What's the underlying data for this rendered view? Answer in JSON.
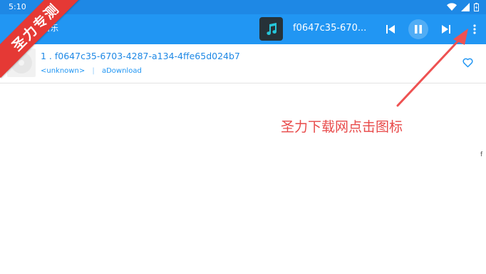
{
  "status_bar": {
    "time": "5:10"
  },
  "app_bar": {
    "title_fragment": "音乐",
    "now_playing_title": "f0647c35-670..."
  },
  "track_list": [
    {
      "title": "1 . f0647c35-6703-4287-a134-4ffe65d024b7",
      "artist": "<unknown>",
      "separator": "|",
      "album": "aDownload"
    }
  ],
  "overlay": {
    "watermark": "圣力专测",
    "annotation": "圣力下载网点击图标",
    "edge_glyph": "f"
  },
  "colors": {
    "status_bar": "#1e88e5",
    "app_bar": "#2196f3",
    "accent_text": "#1e88e5",
    "annotation_red": "#e84a4a",
    "watermark_red": "#e53935"
  },
  "icons": {
    "status": [
      "wifi-icon",
      "signal-icon",
      "battery-icon"
    ],
    "toolbar": [
      "music-note-icon",
      "skip-previous-icon",
      "pause-icon",
      "skip-next-icon",
      "more-vert-icon"
    ],
    "row": [
      "disc-icon",
      "heart-outline-icon"
    ]
  }
}
